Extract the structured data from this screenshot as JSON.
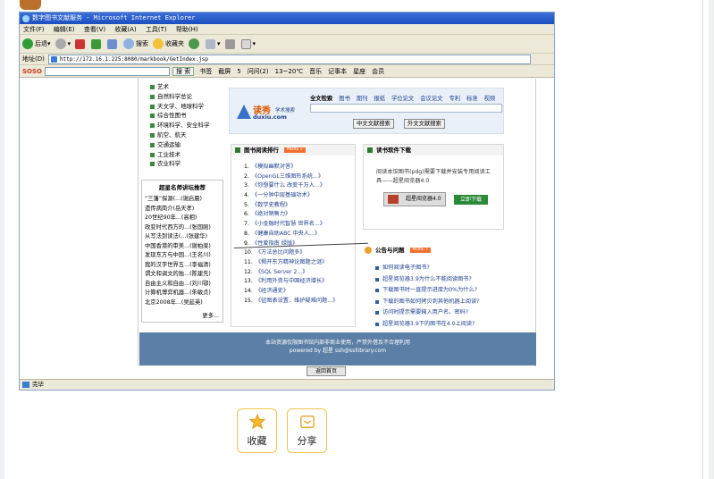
{
  "window": {
    "title": "数字图书文献服务 - Microsoft Internet Explorer"
  },
  "menubar": [
    "文件(F)",
    "编辑(E)",
    "查看(V)",
    "收藏(A)",
    "工具(T)",
    "帮助(H)"
  ],
  "toolbar": {
    "back": "后退",
    "search": "搜索",
    "favorites": "收藏夹"
  },
  "address": {
    "label": "地址(D)",
    "url": "http://172.16.1.225:8080/markbook/GetIndex.jsp"
  },
  "sosobar": {
    "logo": "SOSO",
    "search_btn": "搜 索",
    "items": [
      "书签",
      "截屏",
      "5",
      "问问(2)",
      "13~20℃",
      "音乐",
      "记事本",
      "星座",
      "会员"
    ]
  },
  "categories": [
    "艺术",
    "自然科学总论",
    "天文学、地球科学",
    "综合性图书",
    "环境科学、安全科学",
    "航空、航天",
    "交通运输",
    "工业技术",
    "农业科学"
  ],
  "lecture": {
    "title": "超星名师讲坛推荐",
    "items": [
      "“三藩”探源(...(谢启晨)",
      "遗传病简介(岳天孝)",
      "20世纪90年...(高相)",
      "政变时代西方的...(张国刚)",
      "从写法到读法(...(张建华)",
      "中国香港的审美...(谢柏梁)",
      "发现东方与中国...(王名川)",
      "我的汉字世界五...(李福清)",
      "谓文和调文的独...(陈建先)",
      "自由主义和自由...(刘川鄂)",
      "计算机博弈机器...(朱敏贞)",
      "北京2008年...(吴延英)"
    ],
    "more": "更多..."
  },
  "search": {
    "logo_cn": "读秀",
    "logo_sub": "学术搜索",
    "logo_en": "duxiu.com",
    "tabs": [
      "全文检索",
      "图书",
      "期刊",
      "报纸",
      "学位论文",
      "会议论文",
      "专利",
      "标准",
      "视频"
    ],
    "btn_cn": "中文文献搜索",
    "btn_foreign": "外文文献搜索"
  },
  "ranking": {
    "title": "图书阅读排行",
    "more": "MORE »",
    "items": [
      {
        "n": "1.",
        "t": "《模拟幽默对答》"
      },
      {
        "n": "2.",
        "t": "《OpenGL三维图形系统...》"
      },
      {
        "n": "3.",
        "t": "《你想要什么 改变千万人...》"
      },
      {
        "n": "4.",
        "t": "《一分钟中层基础功术》"
      },
      {
        "n": "5.",
        "t": "《数学史教程》"
      },
      {
        "n": "6.",
        "t": "《绝对销售力》"
      },
      {
        "n": "7.",
        "t": "《小金融时代智慧 世界名...》"
      },
      {
        "n": "8.",
        "t": "《健康自助ABC 中央人...》"
      },
      {
        "n": "9.",
        "t": "《性爱指南 绿版》"
      },
      {
        "n": "10.",
        "t": "《方法总比问题多》"
      },
      {
        "n": "11.",
        "t": "《揭开东方精神论图题之谜》"
      },
      {
        "n": "12.",
        "t": "《SQL Server 2...》"
      },
      {
        "n": "13.",
        "t": "《利用外资与中国经济增长》"
      },
      {
        "n": "14.",
        "t": "《经济通史》"
      },
      {
        "n": "15.",
        "t": "《征图表设置、维护疑难问题...》"
      }
    ]
  },
  "download": {
    "title": "读书软件下载",
    "desc": "阅读本馆图书(pdg)需要下载并安装专用阅读工具——超星阅览器4.0",
    "reader": "超星阅览器4.0",
    "go": "立即下载"
  },
  "notice": {
    "title": "公告与问题",
    "more": "MORE »",
    "items": [
      "如何阅读电子图书?",
      "超星阅览器3.9为什么不能阅读图书?",
      "下载图书时一直提示进度为0%为什么?",
      "下载的图书如何拷贝到其他机器上阅读?",
      "访问时提示需要输入用户名、密码?",
      "超星阅览器3.9下的图书在4.0上阅读?"
    ]
  },
  "footer": {
    "line1": "本站资源仅限图书馆内部非商业使用，严禁外借及不合理利用",
    "line2": "powered by 超星  ssh@ssllibrary.com"
  },
  "back_button": "返回首页",
  "statusbar": "完毕",
  "share": {
    "favorite": "收藏",
    "share": "分享"
  }
}
